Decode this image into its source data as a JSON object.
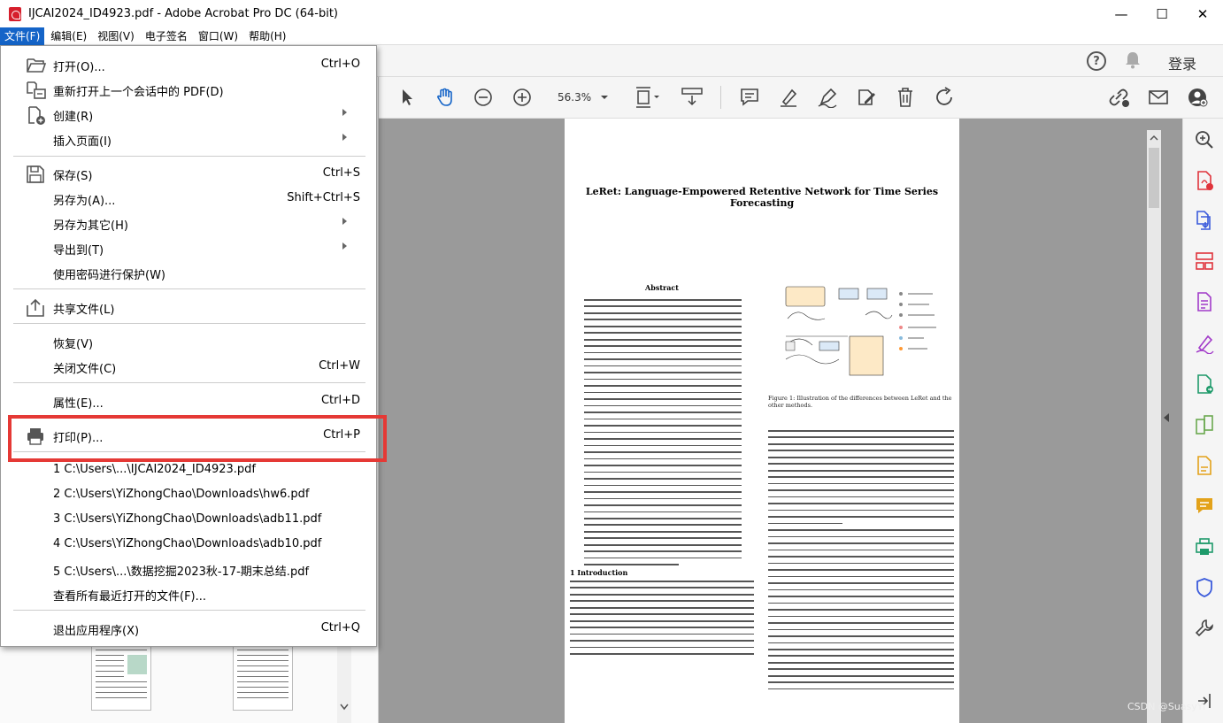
{
  "window": {
    "title": "IJCAI2024_ID4923.pdf - Adobe Acrobat Pro DC (64-bit)",
    "minimize": "—",
    "maximize": "☐",
    "close": "✕"
  },
  "menubar": {
    "items": [
      "文件(F)",
      "编辑(E)",
      "视图(V)",
      "电子签名",
      "窗口(W)",
      "帮助(H)"
    ]
  },
  "topbar": {
    "help": "?",
    "login": "登录"
  },
  "toolbar": {
    "zoom": "56.3%"
  },
  "file_menu": {
    "items": [
      {
        "label": "打开(O)...",
        "shortcut": "Ctrl+O",
        "icon": "folder-open-icon"
      },
      {
        "label": "重新打开上一个会话中的 PDF(D)",
        "shortcut": "",
        "icon": "reopen-icon"
      },
      {
        "label": "创建(R)",
        "shortcut": "",
        "icon": "create-icon",
        "submenu": true
      },
      {
        "label": "插入页面(I)",
        "shortcut": "",
        "submenu": true
      },
      {
        "label": "保存(S)",
        "shortcut": "Ctrl+S",
        "icon": "save-icon"
      },
      {
        "label": "另存为(A)...",
        "shortcut": "Shift+Ctrl+S"
      },
      {
        "label": "另存为其它(H)",
        "shortcut": "",
        "submenu": true
      },
      {
        "label": "导出到(T)",
        "shortcut": "",
        "submenu": true
      },
      {
        "label": "使用密码进行保护(W)",
        "shortcut": ""
      },
      {
        "label": "共享文件(L)",
        "shortcut": "",
        "icon": "share-icon"
      },
      {
        "label": "恢复(V)",
        "shortcut": ""
      },
      {
        "label": "关闭文件(C)",
        "shortcut": "Ctrl+W"
      },
      {
        "label": "属性(E)...",
        "shortcut": "Ctrl+D"
      },
      {
        "label": "打印(P)...",
        "shortcut": "Ctrl+P",
        "icon": "printer-icon"
      },
      {
        "label": "1 C:\\Users\\...\\IJCAI2024_ID4923.pdf",
        "shortcut": ""
      },
      {
        "label": "2 C:\\Users\\YiZhongChao\\Downloads\\hw6.pdf",
        "shortcut": ""
      },
      {
        "label": "3 C:\\Users\\YiZhongChao\\Downloads\\adb11.pdf",
        "shortcut": ""
      },
      {
        "label": "4 C:\\Users\\YiZhongChao\\Downloads\\adb10.pdf",
        "shortcut": ""
      },
      {
        "label": "5 C:\\Users\\...\\数据挖掘2023秋-17-期末总结.pdf",
        "shortcut": ""
      },
      {
        "label": "查看所有最近打开的文件(F)...",
        "shortcut": ""
      },
      {
        "label": "退出应用程序(X)",
        "shortcut": "Ctrl+Q"
      }
    ]
  },
  "document": {
    "title": "LeRet: Language-Empowered Retentive Network for Time Series Forecasting",
    "abstract_heading": "Abstract",
    "section1": "1    Introduction",
    "figure_caption": "Figure 1: Illustration of the differences between LeRet and the other methods."
  },
  "watermark": "CSDN @SuasyYi",
  "colors": {
    "accent": "#1464c8",
    "highlight": "#e53935",
    "brand": "#d61f2c"
  }
}
